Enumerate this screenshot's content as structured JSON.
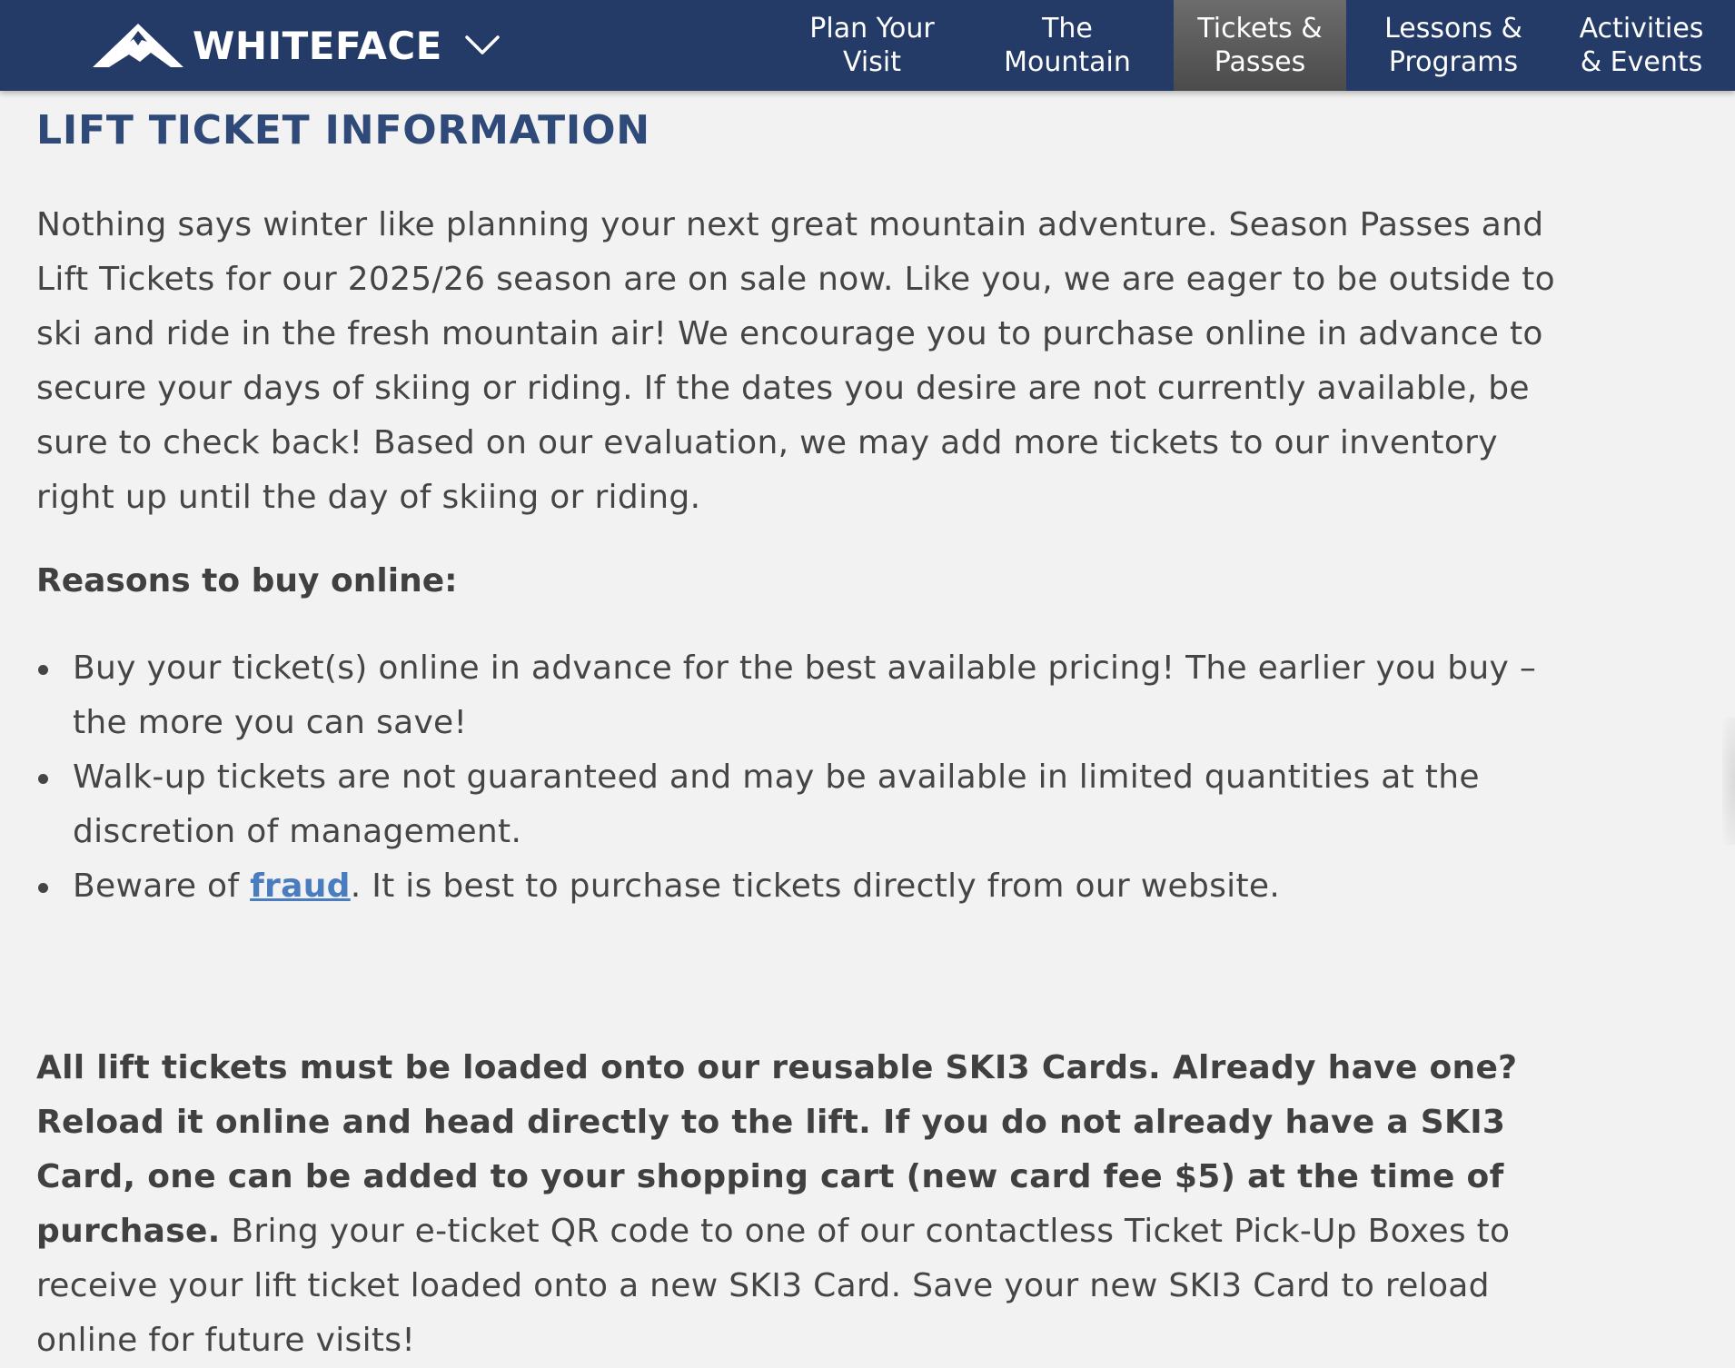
{
  "header": {
    "brand": "WHITEFACE",
    "nav": [
      {
        "label": "Plan Your\nVisit",
        "active": false
      },
      {
        "label": "The\nMountain",
        "active": false
      },
      {
        "label": "Tickets &\nPasses",
        "active": true
      },
      {
        "label": "Lessons &\nPrograms",
        "active": false
      },
      {
        "label": "Activities\n& Events",
        "active": false
      }
    ],
    "colors": {
      "nav_bg": "#243b67",
      "active_bg": "#5b5b5b"
    }
  },
  "main": {
    "title": "LIFT TICKET INFORMATION",
    "intro": "Nothing says winter like planning your next great mountain adventure. Season Passes and Lift Tickets for our 2025/26 season are on sale now. Like you, we are eager to be outside to ski and ride in the fresh mountain air! We encourage you to purchase online in advance to secure your days of skiing or riding. If the dates you desire are not currently available, be sure to check back! Based on our evaluation, we may add more tickets to our inventory right up until the day of skiing or riding.",
    "reasons_heading": "Reasons to buy online:",
    "reasons": [
      {
        "text": "Buy your ticket(s) online in advance for the best available pricing! The earlier you buy – the more you can save!"
      },
      {
        "text": "Walk-up tickets are not guaranteed and may be available in limited quantities at the discretion of management."
      },
      {
        "prefix": "Beware of ",
        "link": "fraud",
        "suffix": ". It is best to purchase tickets directly from our website."
      }
    ],
    "ski3_bold": "All lift tickets must be loaded onto our reusable SKI3 Cards. Already have one? Reload it online and head directly to the lift. If you do not already have a SKI3 Card, one can be added to your shopping cart (new card fee $5) at the time of purchase.",
    "ski3_rest": " Bring your e-ticket QR code to one of our contactless Ticket Pick-Up Boxes to receive your lift ticket loaded onto a new SKI3 Card. Save your new SKI3 Card to reload online for future visits!",
    "colors": {
      "title": "#2f4978",
      "link": "#4a7cc0",
      "body_text": "#454545",
      "page_bg": "#f2f2f2"
    }
  },
  "icons": {
    "logo": "mountain-logo-icon",
    "menu": "chevron-down-icon"
  }
}
